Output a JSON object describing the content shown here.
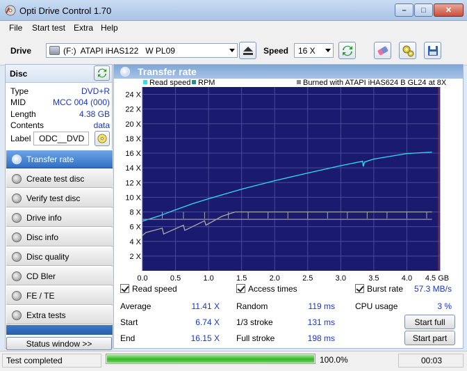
{
  "window": {
    "title": "Opti Drive Control 1.70",
    "min": "–",
    "max": "□",
    "close": "✕"
  },
  "menu": {
    "items": [
      "File",
      "Start test",
      "Extra",
      "Help"
    ]
  },
  "toolbar": {
    "drive_label": "Drive",
    "drive_value": "(F:)  ATAPI iHAS122   W PL09",
    "speed_label": "Speed",
    "speed_value": "16 X"
  },
  "disc": {
    "heading": "Disc",
    "rows": [
      {
        "k": "Type",
        "v": "DVD+R"
      },
      {
        "k": "MID",
        "v": "MCC 004 (000)"
      },
      {
        "k": "Length",
        "v": "4.38 GB"
      },
      {
        "k": "Contents",
        "v": "data"
      }
    ],
    "label_key": "Label",
    "label_value": "ODC__DVD"
  },
  "nav": {
    "items": [
      "Transfer rate",
      "Create test disc",
      "Verify test disc",
      "Drive info",
      "Disc info",
      "Disc quality",
      "CD Bler",
      "FE / TE",
      "Extra tests"
    ],
    "status_window": "Status window >>"
  },
  "panel": {
    "title": "Transfer rate"
  },
  "chart_data": {
    "type": "line",
    "legend": [
      "Read speed",
      "RPM"
    ],
    "burned_note": "Burned with ATAPI iHAS624   B GL24 at 8X",
    "x_unit": "GB",
    "xlim": [
      0,
      4.5
    ],
    "ylim": [
      0,
      25
    ],
    "x_ticks": [
      "0.0",
      "0.5",
      "1.0",
      "1.5",
      "2.0",
      "2.5",
      "3.0",
      "3.5",
      "4.0",
      "4.5 GB"
    ],
    "y_ticks": [
      "2 X",
      "4 X",
      "6 X",
      "8 X",
      "10 X",
      "12 X",
      "14 X",
      "16 X",
      "18 X",
      "20 X",
      "22 X",
      "24 X"
    ],
    "grid": true,
    "series": [
      {
        "name": "Read speed",
        "color": "#2fdff2",
        "x": [
          0,
          0.25,
          0.5,
          0.75,
          1.0,
          1.5,
          2.0,
          2.5,
          3.0,
          3.33,
          3.34,
          3.36,
          3.5,
          4.0,
          4.38
        ],
        "y": [
          6.74,
          7.45,
          8.3,
          9.1,
          9.8,
          11.1,
          12.25,
          13.3,
          14.3,
          14.9,
          14.2,
          14.8,
          15.2,
          15.95,
          16.15
        ]
      },
      {
        "name": "Burned with ATAPI iHAS624",
        "color": "#a8a8a8",
        "x": [
          0,
          0.05,
          0.3,
          0.32,
          0.62,
          0.64,
          0.94,
          0.96,
          1.2,
          1.4,
          4.38
        ],
        "y": [
          4.8,
          5.2,
          5.8,
          5.0,
          6.2,
          5.5,
          6.8,
          6.2,
          7.4,
          8.0,
          8.0
        ]
      },
      {
        "name": "RPM",
        "color": "#9a9a9a",
        "x": [
          0,
          4.38
        ],
        "y": [
          7.0,
          7.0
        ]
      }
    ]
  },
  "stats": {
    "read_speed": "Read speed",
    "access_times": "Access times",
    "burst_rate_k": "Burst rate",
    "burst_rate_v": "57.3 MB/s",
    "average_k": "Average",
    "average_v": "11.41 X",
    "start_k": "Start",
    "start_v": "6.74 X",
    "end_k": "End",
    "end_v": "16.15 X",
    "random_k": "Random",
    "random_v": "119 ms",
    "third_k": "1/3 stroke",
    "third_v": "131 ms",
    "full_k": "Full stroke",
    "full_v": "198 ms",
    "cpu_k": "CPU usage",
    "cpu_v": "3 %",
    "start_full": "Start full",
    "start_part": "Start part"
  },
  "status": {
    "text": "Test completed",
    "progress_fraction": 1.0,
    "progress_text": "100.0%",
    "time": "00:03"
  }
}
